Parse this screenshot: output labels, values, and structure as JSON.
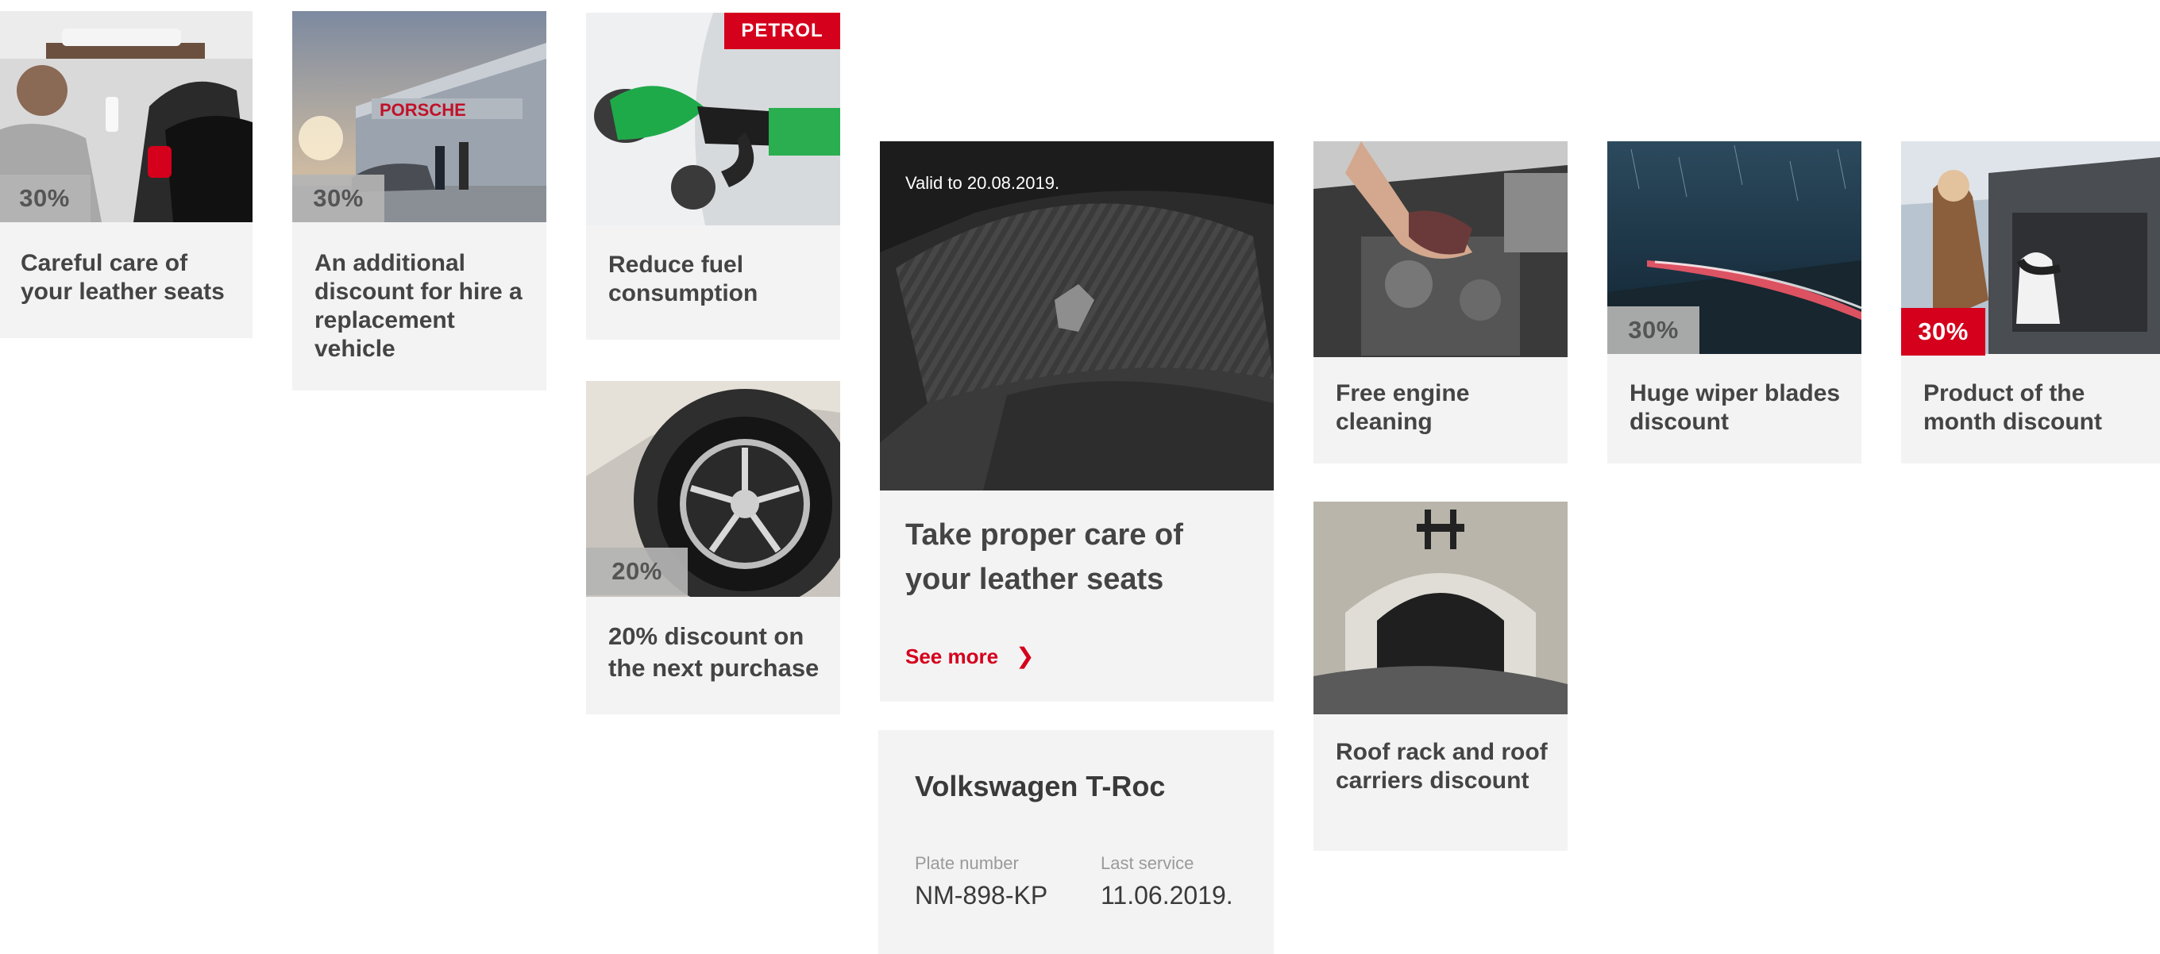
{
  "offers": [
    {
      "title": "Careful care of your leather seats",
      "badge": "30%"
    },
    {
      "title": "An additional discount for hire a replacement vehicle",
      "badge": "30%"
    },
    {
      "title": "Reduce fuel consumption",
      "tag": "PETROL"
    },
    {
      "title": "20% discount on the next purchase",
      "badge": "20%"
    },
    {
      "title": "Free engine cleaning"
    },
    {
      "title": "Huge wiper blades discount",
      "badge": "30%"
    },
    {
      "title": "Product of the month discount",
      "badge": "30%"
    },
    {
      "title": "Roof rack and roof carriers discount"
    }
  ],
  "featured": {
    "valid": "Valid to 20.08.2019.",
    "title": "Take proper care of your leather seats",
    "cta": "See more"
  },
  "vehicle": {
    "name": "Volkswagen T-Roc",
    "plate_label": "Plate number",
    "plate": "NM-898-KP",
    "service_label": "Last service",
    "service": "11.06.2019."
  },
  "colors": {
    "accent": "#d5001c",
    "card": "#f3f3f3",
    "badge": "#b4b4b4"
  }
}
